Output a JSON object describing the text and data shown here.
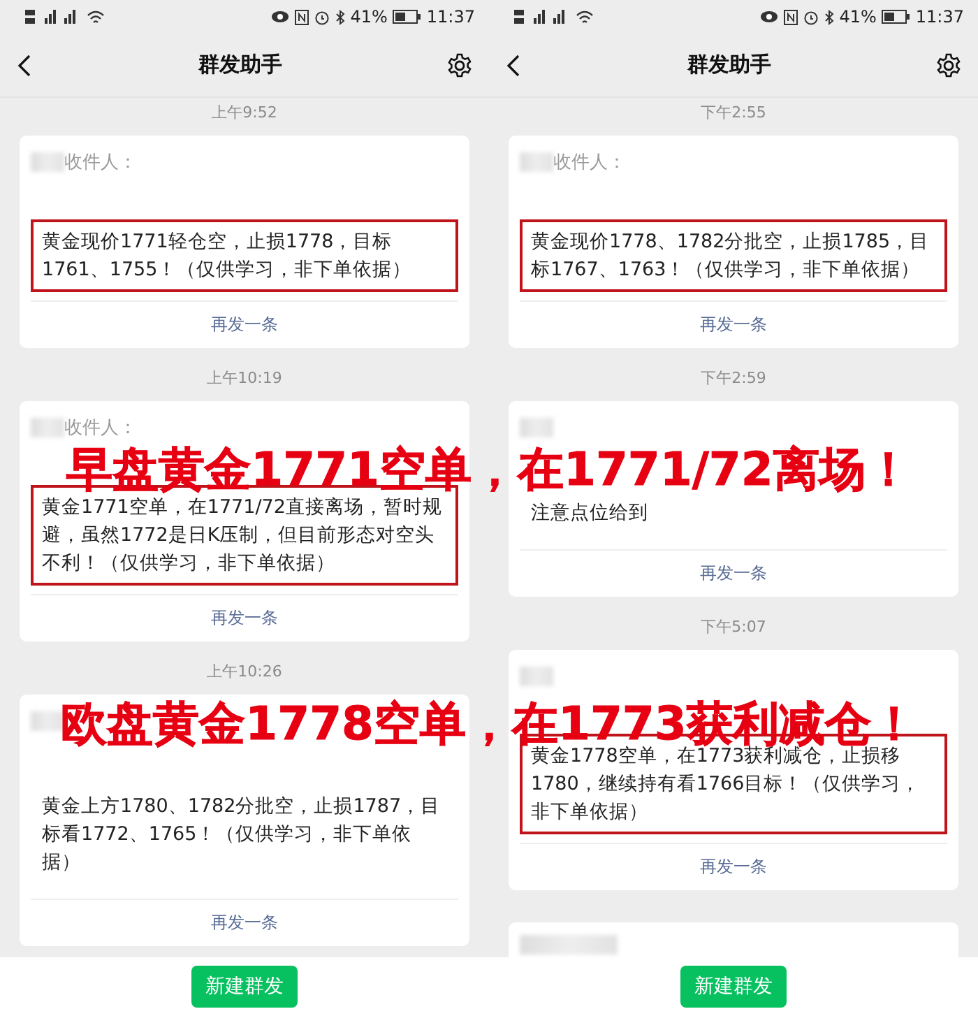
{
  "phones": [
    {
      "status_bar": {
        "battery": "41%",
        "time": "11:37"
      },
      "title": "群发助手",
      "new_button": "新建群发",
      "messages": [
        {
          "kind": "message",
          "time": "上午9:52",
          "recipient_label": "收件人：",
          "body": "黄金现价1771轻仓空，止损1778，目标1761、1755！（仅供学习，非下单依据）",
          "highlighted": true,
          "resend": "再发一条"
        },
        {
          "kind": "message",
          "time": "上午10:19",
          "recipient_label": "收件人：",
          "body": "黄金1771空单，在1771/72直接离场，暂时规避，虽然1772是日K压制，但目前形态对空头不利！（仅供学习，非下单依据）",
          "highlighted": true,
          "resend": "再发一条"
        },
        {
          "kind": "message",
          "time": "上午10:26",
          "body": "黄金上方1780、1782分批空，止损1787，目标看1772、1765！（仅供学习，非下单依据）",
          "highlighted": false,
          "resend": "再发一条"
        }
      ]
    },
    {
      "status_bar": {
        "battery": "41%",
        "time": "11:37"
      },
      "title": "群发助手",
      "new_button": "新建群发",
      "messages": [
        {
          "kind": "message",
          "time": "下午2:55",
          "recipient_label": "收件人：",
          "body": "黄金现价1778、1782分批空，止损1785，目标1767、1763！（仅供学习，非下单依据）",
          "highlighted": true,
          "resend": "再发一条"
        },
        {
          "kind": "message",
          "time": "下午2:59",
          "body": "注意点位给到",
          "highlighted": false,
          "resend": "再发一条"
        },
        {
          "kind": "message",
          "time": "下午5:07",
          "body": "黄金1778空单，在1773获利减仓，止损移1780，继续持有看1766目标！（仅供学习，非下单依据）",
          "highlighted": true,
          "resend": "再发一条"
        },
        {
          "kind": "partial"
        }
      ]
    }
  ],
  "overlays": [
    "早盘黄金1771空单，在1771/72离场！",
    "欧盘黄金1778空单，在1773获利减仓！"
  ]
}
